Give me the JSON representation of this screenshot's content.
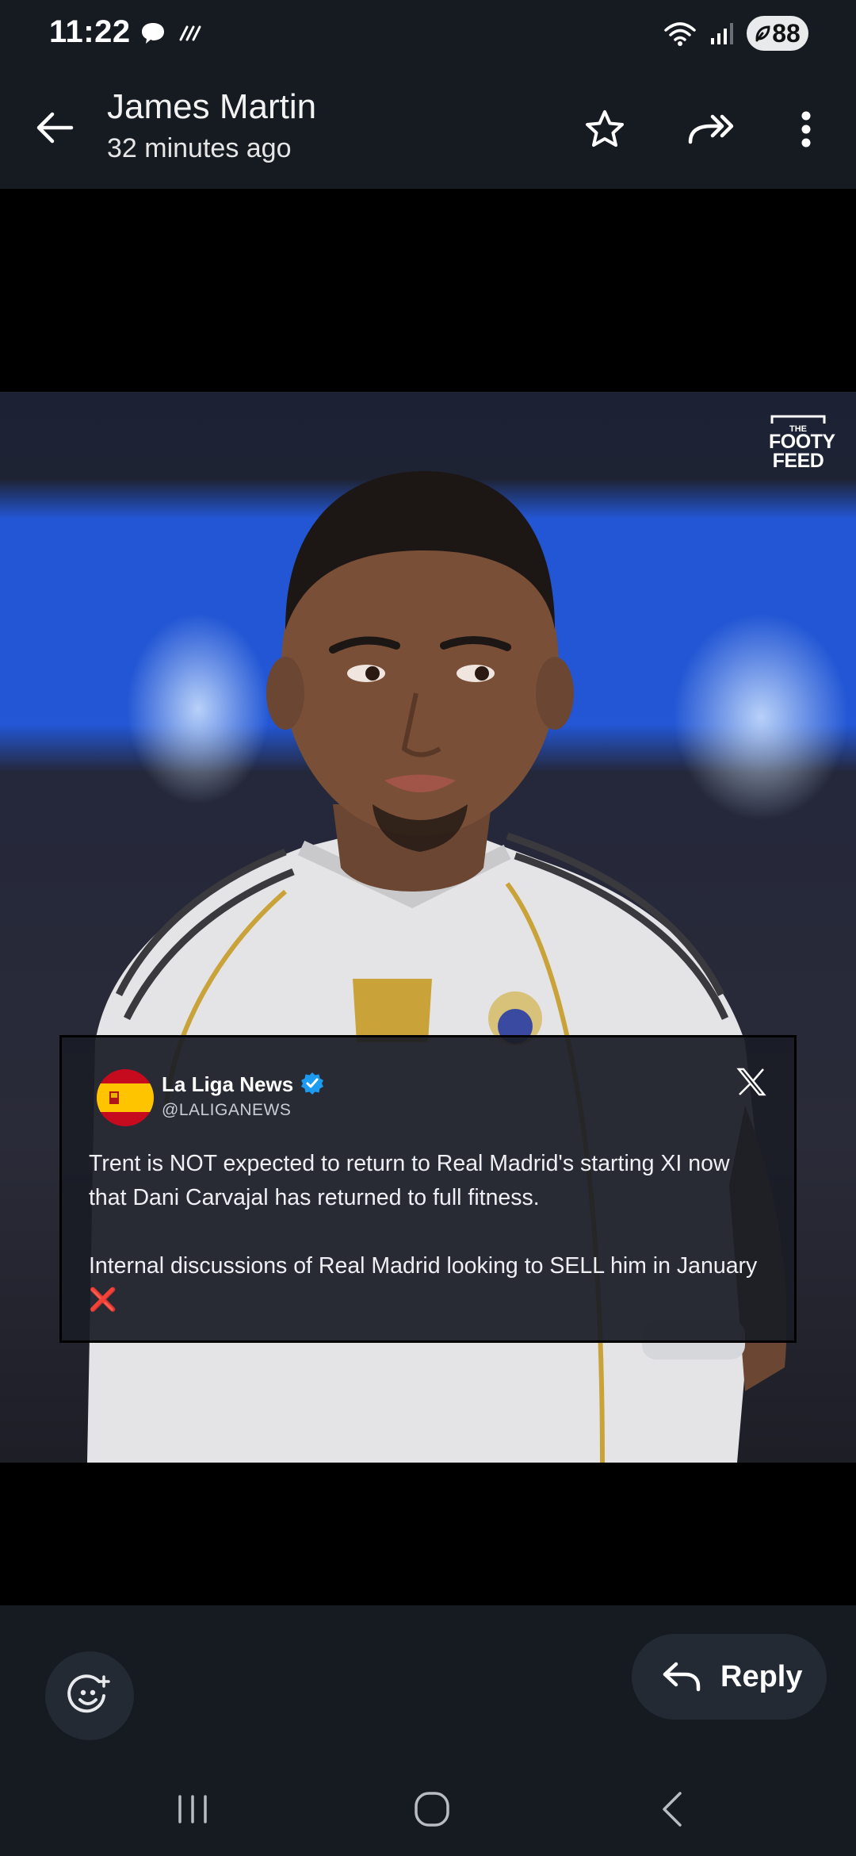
{
  "status_bar": {
    "time": "11:22",
    "battery": "88"
  },
  "header": {
    "sender_name": "James Martin",
    "sent_time": "32 minutes ago"
  },
  "media": {
    "brand_logo": "THE FOOTY FEED",
    "tweet": {
      "name": "La Liga News",
      "handle": "@LALIGANEWS",
      "paragraph_1": "Trent is NOT expected to return to Real Madrid's starting XI now that Dani Carvajal has returned to full fitness.",
      "paragraph_2": "Internal discussions of Real Madrid looking to SELL him in January",
      "emoji": "❌",
      "platform_icon": "x-logo-icon",
      "verified_color": "#1d9bf0"
    }
  },
  "bottom_bar": {
    "reply_label": "Reply"
  },
  "colors": {
    "bar_background": "#161b22",
    "button_background": "#242a33"
  }
}
